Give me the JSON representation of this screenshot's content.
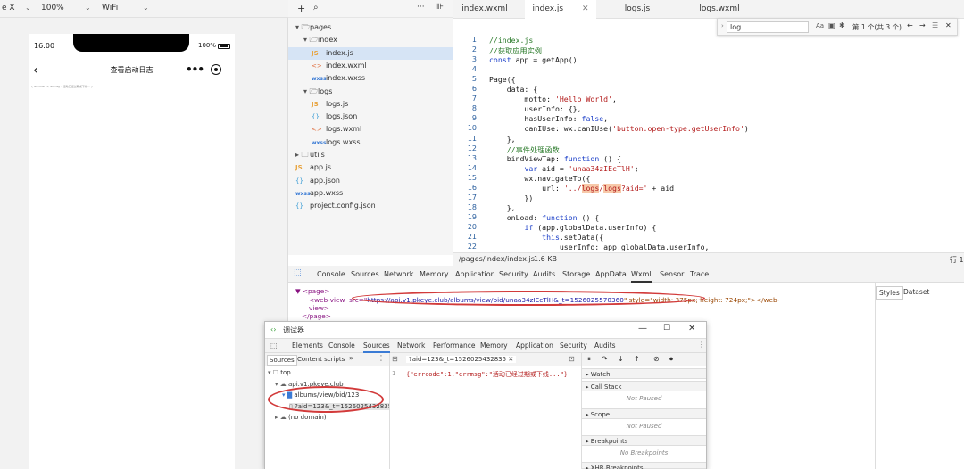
{
  "simulator": {
    "device": "e X",
    "zoom": "100%",
    "network": "WiFi",
    "status_time": "16:00",
    "battery": "100%",
    "page_title": "查看启动日志",
    "tiny_text": "{\"errcode\":1,\"errmsg\":\"活动已经过期或下线...\"}"
  },
  "explorer": {
    "tree": [
      {
        "label": "pages",
        "icon": "folder-open-icon",
        "indent": 0
      },
      {
        "label": "index",
        "icon": "folder-open-icon",
        "indent": 1
      },
      {
        "label": "index.js",
        "icon": "js-file-icon",
        "indent": 2,
        "selected": true
      },
      {
        "label": "index.wxml",
        "icon": "wxml-file-icon",
        "indent": 2
      },
      {
        "label": "index.wxss",
        "icon": "wxss-file-icon",
        "indent": 2
      },
      {
        "label": "logs",
        "icon": "folder-open-icon",
        "indent": 1
      },
      {
        "label": "logs.js",
        "icon": "js-file-icon",
        "indent": 2
      },
      {
        "label": "logs.json",
        "icon": "json-file-icon",
        "indent": 2
      },
      {
        "label": "logs.wxml",
        "icon": "wxml-file-icon",
        "indent": 2
      },
      {
        "label": "logs.wxss",
        "icon": "wxss-file-icon",
        "indent": 2
      },
      {
        "label": "utils",
        "icon": "folder-closed-icon",
        "indent": 0
      },
      {
        "label": "app.js",
        "icon": "js-file-icon",
        "indent": 0
      },
      {
        "label": "app.json",
        "icon": "json-file-icon",
        "indent": 0
      },
      {
        "label": "app.wxss",
        "icon": "wxss-file-icon",
        "indent": 0
      },
      {
        "label": "project.config.json",
        "icon": "json-file-icon",
        "indent": 0
      }
    ]
  },
  "editor": {
    "tabs": [
      "index.wxml",
      "index.js",
      "logs.js",
      "logs.wxml"
    ],
    "active_tab": "index.js",
    "search": {
      "query": "log",
      "options": "Aa",
      "result": "第 1 个(共 3 个)"
    },
    "lines": [
      "//index.js",
      "//获取应用实例",
      "const app = getApp()",
      "",
      "Page({",
      "    data: {",
      "        motto: 'Hello World',",
      "        userInfo: {},",
      "        hasUserInfo: false,",
      "        canIUse: wx.canIUse('button.open-type.getUserInfo')",
      "    },",
      "    //事件处理函数",
      "    bindViewTap: function () {",
      "        var aid = 'unaa34zIEcTlH';",
      "        wx.navigateTo({",
      "            url: '../logs/logs?aid=' + aid",
      "        })",
      "    },",
      "    onLoad: function () {",
      "        if (app.globalData.userInfo) {",
      "            this.setData({",
      "                userInfo: app.globalData.userInfo,"
    ],
    "status_path": "/pages/index/index.js",
    "status_size": "1.6 KB",
    "status_right": "行 1"
  },
  "devtools": {
    "tabs": [
      "Console",
      "Sources",
      "Network",
      "Memory",
      "Application",
      "Security",
      "Audits",
      "Storage",
      "AppData",
      "Wxml",
      "Sensor",
      "Trace"
    ],
    "active_tab": "Wxml",
    "xml_page_open": "▼ <page>",
    "xml_webview_prefix": "<web-view  src=\"",
    "xml_webview_src": "https://api.v1.pkeye.club/albums/view/bid/unaa34zIEcTlH&_t=1526025570360",
    "xml_webview_style": "\" style=\"width: 375px; height: 724px;\"></web-",
    "xml_view_close": "view>",
    "xml_page_close": "</page>",
    "side_tabs": [
      "Styles",
      "Dataset"
    ]
  },
  "debugger": {
    "title": "调试器",
    "tabs": [
      "Elements",
      "Console",
      "Sources",
      "Network",
      "Performance",
      "Memory",
      "Application",
      "Security",
      "Audits"
    ],
    "active_tab": "Sources",
    "nav_tabs": [
      "Sources",
      "Content scripts"
    ],
    "tree": [
      {
        "label": "top",
        "indent": 0
      },
      {
        "label": "api.v1.pkeye.club",
        "indent": 1
      },
      {
        "label": "albums/view/bid/123",
        "indent": 2
      },
      {
        "label": "?aid=123&_t=1526025432835",
        "indent": 3
      },
      {
        "label": "(no domain)",
        "indent": 1
      }
    ],
    "file_tab": "?aid=123&_t=1526025432835",
    "file_line_no": "1",
    "file_content": "{\"errcode\":1,\"errmsg\":\"活动已经过期或下线...\"}",
    "sections": [
      "Watch",
      "Call Stack",
      "Scope",
      "Breakpoints",
      "XHR Breakpoints"
    ],
    "not_paused": "Not Paused",
    "no_breakpoints": "No Breakpoints"
  }
}
